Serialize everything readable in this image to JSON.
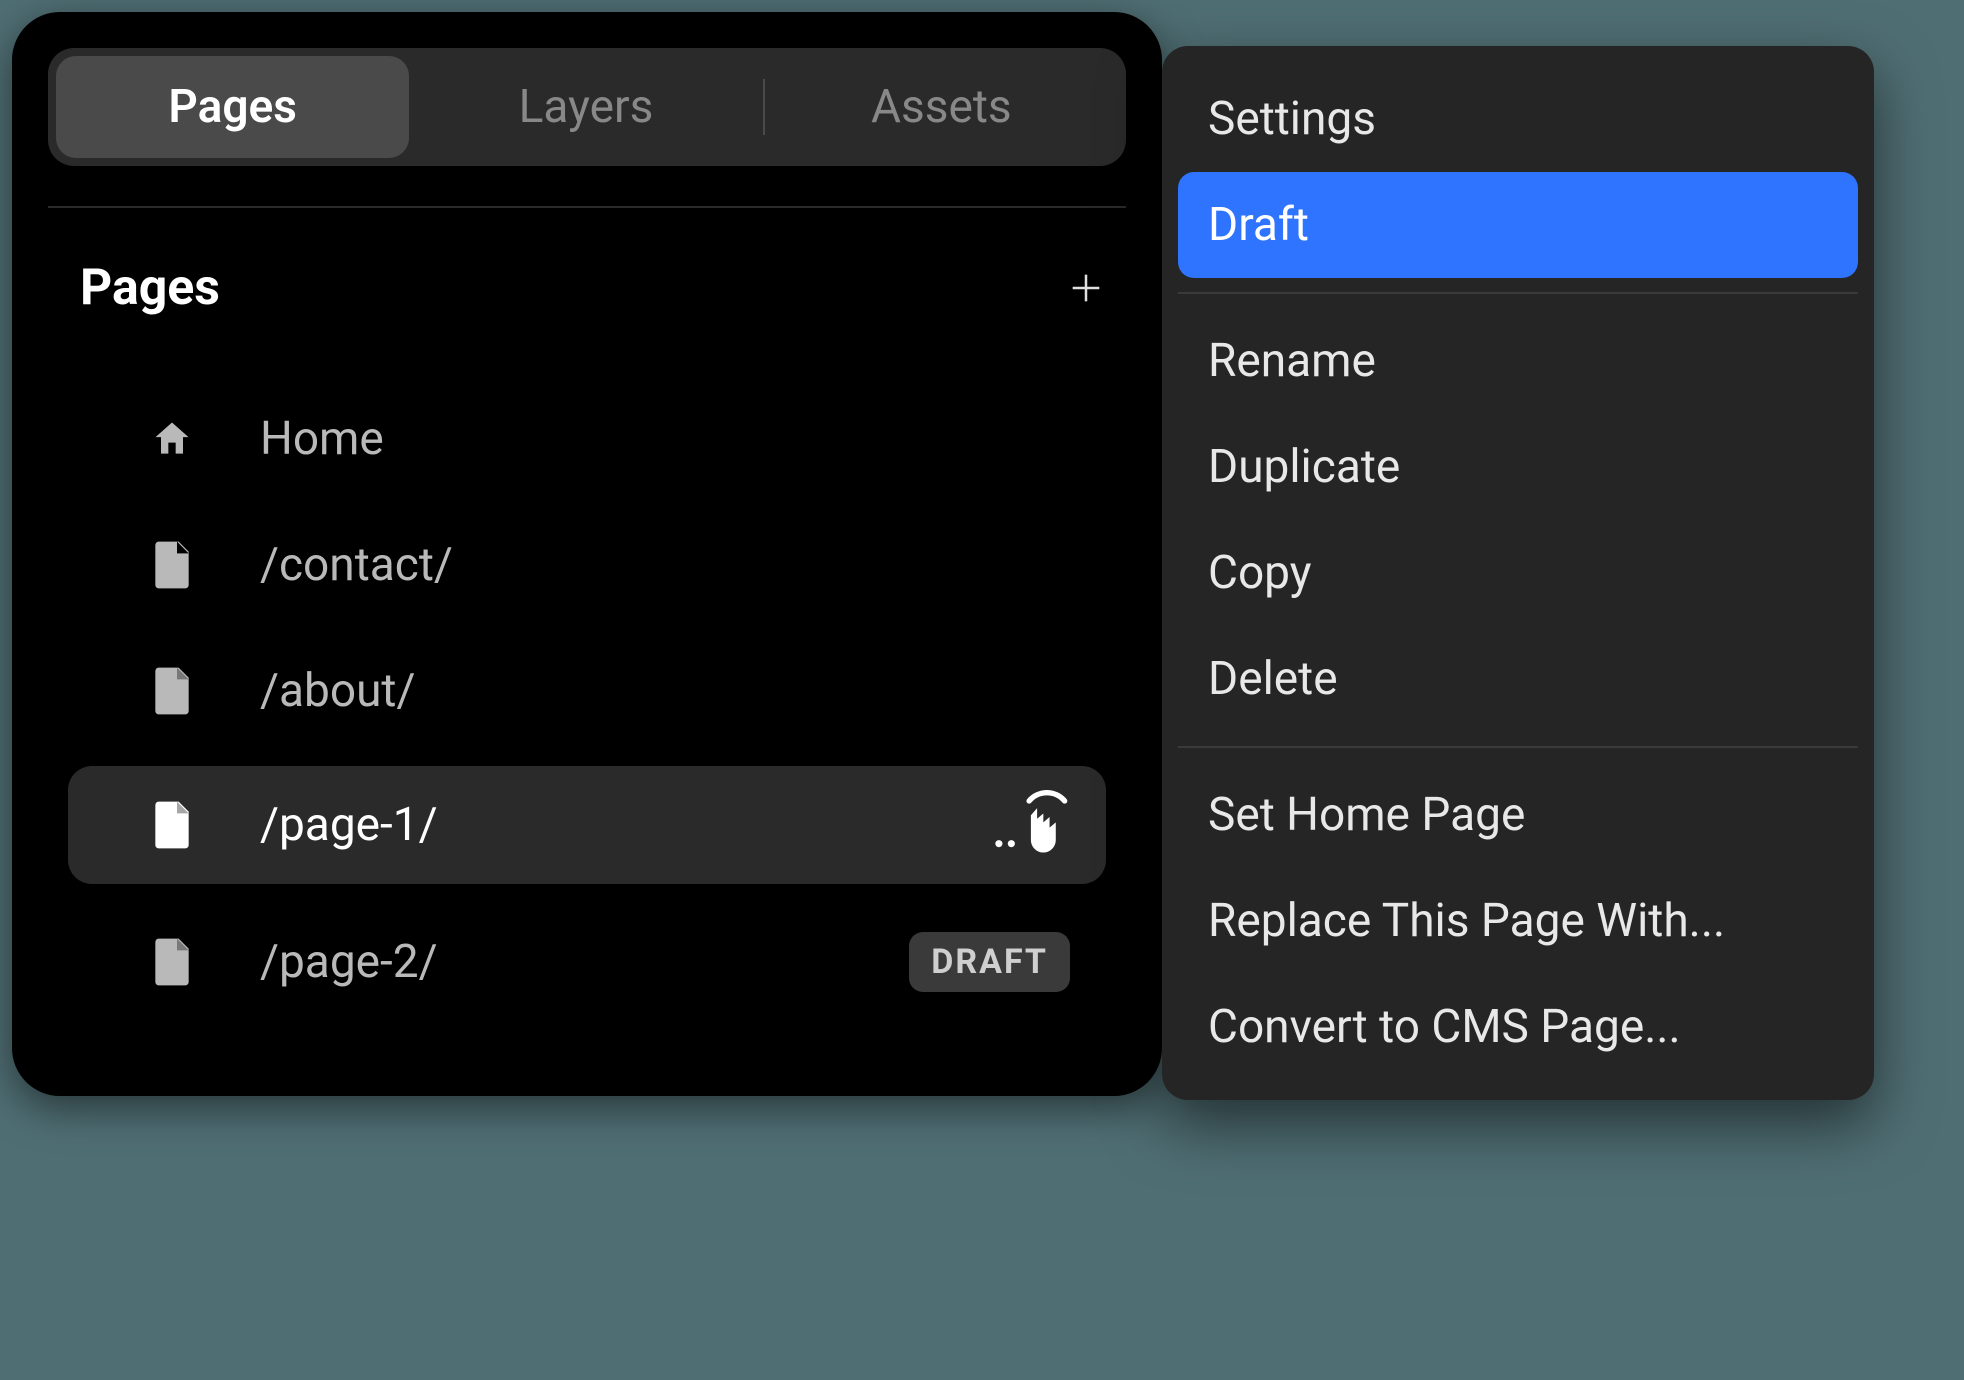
{
  "tabs": {
    "items": [
      {
        "label": "Pages",
        "active": true
      },
      {
        "label": "Layers",
        "active": false
      },
      {
        "label": "Assets",
        "active": false
      }
    ]
  },
  "section": {
    "title": "Pages"
  },
  "pages": [
    {
      "icon": "home",
      "label": "Home",
      "selected": false,
      "badge": null,
      "cursor": false
    },
    {
      "icon": "page",
      "label": "/contact/",
      "selected": false,
      "badge": null,
      "cursor": false
    },
    {
      "icon": "page",
      "label": "/about/",
      "selected": false,
      "badge": null,
      "cursor": false
    },
    {
      "icon": "page",
      "label": "/page-1/",
      "selected": true,
      "badge": null,
      "cursor": true
    },
    {
      "icon": "page",
      "label": "/page-2/",
      "selected": false,
      "badge": "DRAFT",
      "cursor": false
    }
  ],
  "context_menu": {
    "groups": [
      [
        {
          "label": "Settings",
          "highlighted": false
        },
        {
          "label": "Draft",
          "highlighted": true
        }
      ],
      [
        {
          "label": "Rename",
          "highlighted": false
        },
        {
          "label": "Duplicate",
          "highlighted": false
        },
        {
          "label": "Copy",
          "highlighted": false
        },
        {
          "label": "Delete",
          "highlighted": false
        }
      ],
      [
        {
          "label": "Set Home Page",
          "highlighted": false
        },
        {
          "label": "Replace This Page With...",
          "highlighted": false
        },
        {
          "label": "Convert to CMS Page...",
          "highlighted": false
        }
      ]
    ]
  }
}
